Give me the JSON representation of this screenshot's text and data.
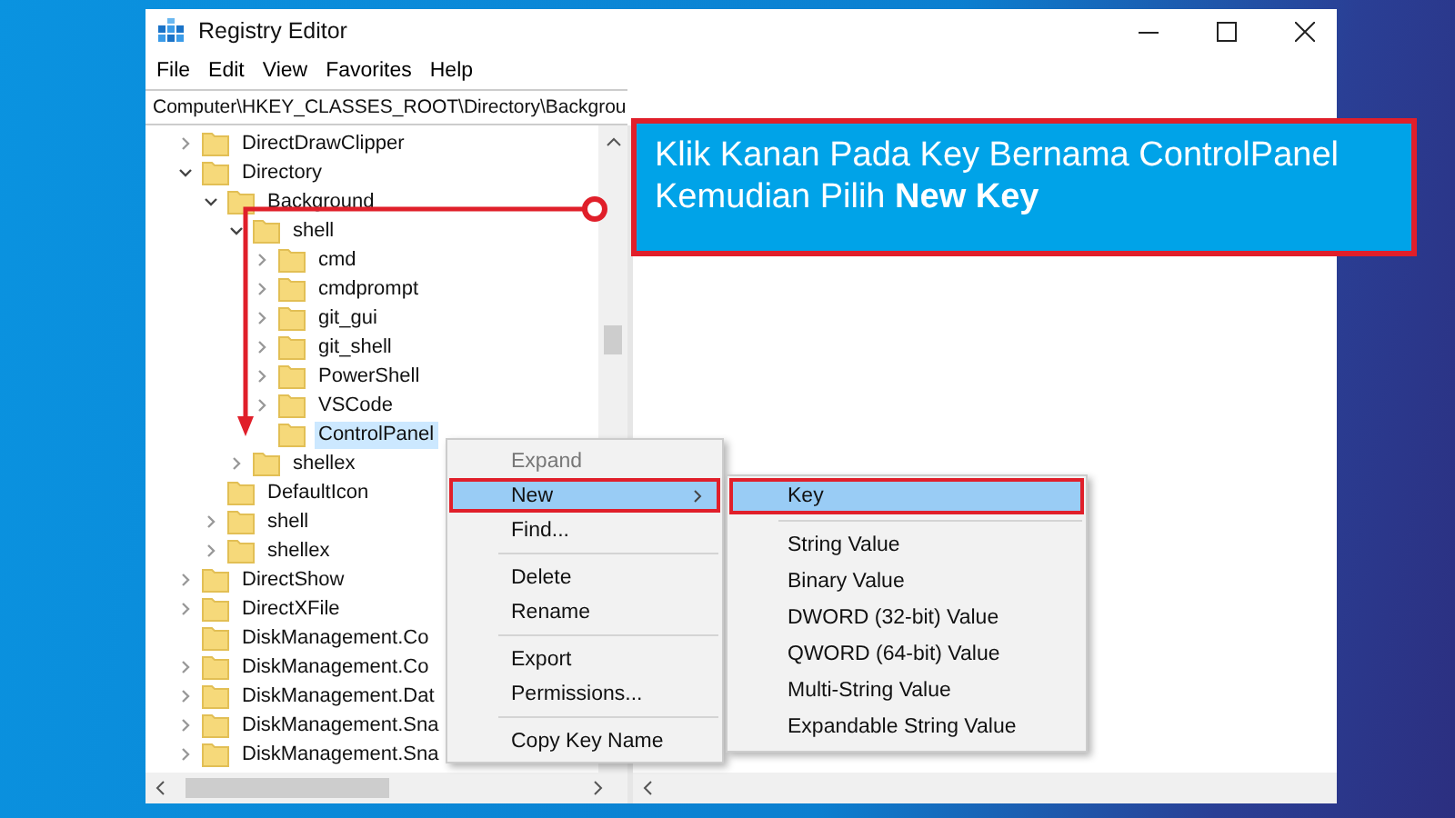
{
  "window": {
    "title": "Registry Editor"
  },
  "menu": [
    "File",
    "Edit",
    "View",
    "Favorites",
    "Help"
  ],
  "address": "Computer\\HKEY_CLASSES_ROOT\\Directory\\Backgrou",
  "tree": [
    {
      "label": "DirectDrawClipper",
      "expandable": true,
      "expanded": false,
      "selected": false
    },
    {
      "label": "Directory",
      "expandable": true,
      "expanded": true,
      "selected": false,
      "children": [
        {
          "label": "Background",
          "expandable": true,
          "expanded": true,
          "selected": false,
          "children": [
            {
              "label": "shell",
              "expandable": true,
              "expanded": true,
              "selected": false,
              "children": [
                {
                  "label": "cmd",
                  "expandable": true,
                  "expanded": false,
                  "selected": false
                },
                {
                  "label": "cmdprompt",
                  "expandable": true,
                  "expanded": false,
                  "selected": false
                },
                {
                  "label": "git_gui",
                  "expandable": true,
                  "expanded": false,
                  "selected": false
                },
                {
                  "label": "git_shell",
                  "expandable": true,
                  "expanded": false,
                  "selected": false
                },
                {
                  "label": "PowerShell",
                  "expandable": true,
                  "expanded": false,
                  "selected": false
                },
                {
                  "label": "VSCode",
                  "expandable": true,
                  "expanded": false,
                  "selected": false
                },
                {
                  "label": "ControlPanel",
                  "expandable": false,
                  "selected": true
                }
              ]
            },
            {
              "label": "shellex",
              "expandable": true,
              "expanded": false,
              "selected": false
            }
          ]
        },
        {
          "label": "DefaultIcon",
          "expandable": false,
          "selected": false
        },
        {
          "label": "shell",
          "expandable": true,
          "expanded": false,
          "selected": false
        },
        {
          "label": "shellex",
          "expandable": true,
          "expanded": false,
          "selected": false
        }
      ]
    },
    {
      "label": "DirectShow",
      "expandable": true,
      "expanded": false,
      "selected": false
    },
    {
      "label": "DirectXFile",
      "expandable": true,
      "expanded": false,
      "selected": false
    },
    {
      "label": "DiskManagement.Co",
      "expandable": false,
      "selected": false
    },
    {
      "label": "DiskManagement.Co",
      "expandable": true,
      "expanded": false,
      "selected": false
    },
    {
      "label": "DiskManagement.Dat",
      "expandable": true,
      "expanded": false,
      "selected": false
    },
    {
      "label": "DiskManagement.Sna",
      "expandable": true,
      "expanded": false,
      "selected": false
    },
    {
      "label": "DiskManagement.Sna",
      "expandable": true,
      "expanded": false,
      "selected": false
    }
  ],
  "context_menu": [
    [
      {
        "label": "Expand",
        "disabled": true,
        "selected": false,
        "submenu": false
      },
      {
        "label": "New",
        "disabled": false,
        "selected": true,
        "submenu": true
      },
      {
        "label": "Find...",
        "disabled": false,
        "selected": false,
        "submenu": false
      }
    ],
    [
      {
        "label": "Delete",
        "disabled": false,
        "selected": false,
        "submenu": false
      },
      {
        "label": "Rename",
        "disabled": false,
        "selected": false,
        "submenu": false
      }
    ],
    [
      {
        "label": "Export",
        "disabled": false,
        "selected": false,
        "submenu": false
      },
      {
        "label": "Permissions...",
        "disabled": false,
        "selected": false,
        "submenu": false
      }
    ],
    [
      {
        "label": "Copy Key Name",
        "disabled": false,
        "selected": false,
        "submenu": false
      }
    ]
  ],
  "submenu": [
    [
      {
        "label": "Key",
        "selected": true
      }
    ],
    [
      {
        "label": "String Value",
        "selected": false
      },
      {
        "label": "Binary Value",
        "selected": false
      },
      {
        "label": "DWORD (32-bit) Value",
        "selected": false
      },
      {
        "label": "QWORD (64-bit) Value",
        "selected": false
      },
      {
        "label": "Multi-String Value",
        "selected": false
      },
      {
        "label": "Expandable String Value",
        "selected": false
      }
    ]
  ],
  "callout": {
    "text": "Klik Kanan Pada Key Bernama ControlPanel Kemudian Pilih **New Key**"
  }
}
